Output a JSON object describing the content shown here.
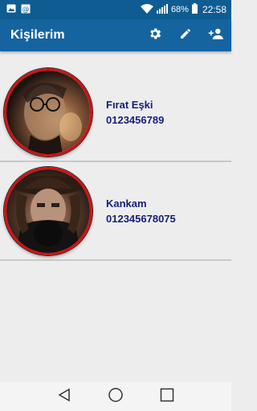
{
  "status_bar": {
    "battery": "68%",
    "time": "22:58",
    "icons": [
      "image-icon",
      "at-icon",
      "wifi-icon",
      "signal-icon",
      "battery-icon"
    ]
  },
  "app_bar": {
    "title": "Kişilerim",
    "actions": [
      "settings-icon",
      "edit-icon",
      "add-person-icon"
    ],
    "color": "#1564a0"
  },
  "contacts": [
    {
      "name": "Fırat Eşki",
      "phone": "0123456789",
      "avatar": "portrait-glasses"
    },
    {
      "name": "Kankam",
      "phone": "012345678075",
      "avatar": "portrait-hat"
    }
  ],
  "colors": {
    "text": "#17207a",
    "avatar_border": "#d60f0f"
  },
  "nav_bar": [
    "back-icon",
    "home-icon",
    "recents-icon"
  ]
}
